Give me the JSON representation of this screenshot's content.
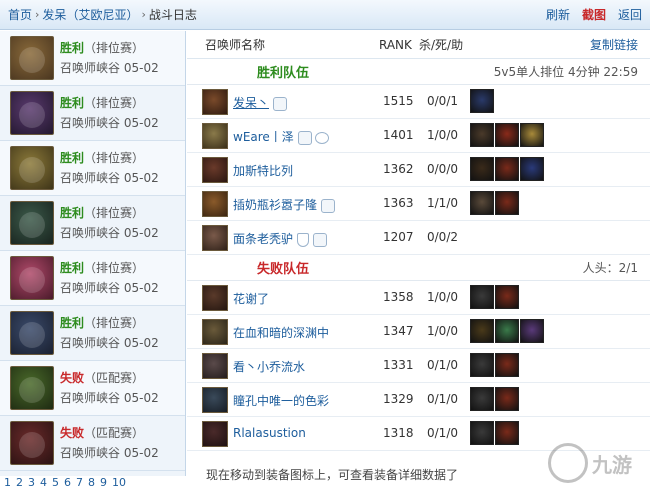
{
  "breadcrumb": {
    "home": "首页",
    "player": "发呆",
    "server": "（艾欧尼亚）",
    "current": "战斗日志",
    "separator": "›"
  },
  "top_actions": {
    "refresh": "刷新",
    "screenshot": "截图",
    "back": "返回"
  },
  "matches": [
    {
      "result": "胜利",
      "mode": "（排位赛）",
      "map": "召唤师峡谷",
      "date": "05-02",
      "win": true,
      "colors": [
        "#8a6a3a",
        "#4a3620"
      ]
    },
    {
      "result": "胜利",
      "mode": "（排位赛）",
      "map": "召唤师峡谷",
      "date": "05-02",
      "win": true,
      "colors": [
        "#5a3a6e",
        "#22172e"
      ]
    },
    {
      "result": "胜利",
      "mode": "（排位赛）",
      "map": "召唤师峡谷",
      "date": "05-02",
      "win": true,
      "colors": [
        "#8c7a3a",
        "#3e3418"
      ]
    },
    {
      "result": "胜利",
      "mode": "（排位赛）",
      "map": "召唤师峡谷",
      "date": "05-02",
      "win": true,
      "colors": [
        "#3c5a4a",
        "#18231e"
      ]
    },
    {
      "result": "胜利",
      "mode": "（排位赛）",
      "map": "召唤师峡谷",
      "date": "05-02",
      "win": true,
      "colors": [
        "#b04a6a",
        "#4a1a2a"
      ]
    },
    {
      "result": "胜利",
      "mode": "（排位赛）",
      "map": "召唤师峡谷",
      "date": "05-02",
      "win": true,
      "colors": [
        "#3a4a6a",
        "#1a2030"
      ]
    },
    {
      "result": "失败",
      "mode": "（匹配赛）",
      "map": "召唤师峡谷",
      "date": "05-02",
      "win": false,
      "colors": [
        "#4a6a2a",
        "#1e2a12"
      ]
    },
    {
      "result": "失败",
      "mode": "（匹配赛）",
      "map": "召唤师峡谷",
      "date": "05-02",
      "win": false,
      "colors": [
        "#6a2a2a",
        "#2a1212"
      ]
    }
  ],
  "pager": [
    "1",
    "2",
    "3",
    "4",
    "5",
    "6",
    "7",
    "8",
    "9",
    "10"
  ],
  "table_header": {
    "name": "召唤师名称",
    "rank": "RANK",
    "kda": "杀/死/助",
    "copy_link": "复制链接"
  },
  "win_team": {
    "title": "胜利队伍",
    "meta": "5v5单人排位 4分钟 22:59",
    "players": [
      {
        "name": "发呆丶",
        "rank": "1515",
        "kda": "0/0/1",
        "icons": "hand",
        "avatar": [
          "#7a4a2a",
          "#2e1a10"
        ],
        "items": [
          "#2a3a6a"
        ]
      },
      {
        "name": "wEare丨泽",
        "rank": "1401",
        "kda": "1/0/0",
        "icons": "hand-circ",
        "avatar": [
          "#8a7a4a",
          "#3a2e18"
        ],
        "items": [
          "#4a3a2a",
          "#8a2a1a",
          "#a88a3a"
        ]
      },
      {
        "name": "加斯特比列",
        "rank": "1362",
        "kda": "0/0/0",
        "icons": "",
        "avatar": [
          "#6a3a2a",
          "#2a1610"
        ],
        "items": [
          "#3a2a1a",
          "#7a2a1a",
          "#2a3a7a"
        ]
      },
      {
        "name": "插奶瓶衫嚣子隆",
        "rank": "1363",
        "kda": "1/1/0",
        "icons": "hand",
        "avatar": [
          "#8a5a2a",
          "#3a2410"
        ],
        "items": [
          "#5a4a3a",
          "#7a2a1a"
        ]
      },
      {
        "name": "面条老秃驴",
        "rank": "1207",
        "kda": "0/0/2",
        "icons": "shield-hand",
        "avatar": [
          "#7a5a4a",
          "#2e2018"
        ],
        "items": []
      }
    ]
  },
  "lose_team": {
    "title": "失败队伍",
    "meta": "人头：2/1",
    "players": [
      {
        "name": "花谢了",
        "rank": "1358",
        "kda": "1/0/0",
        "icons": "",
        "avatar": [
          "#5a3a2a",
          "#241610"
        ],
        "items": [
          "#3a3a3a",
          "#7a2a1a"
        ]
      },
      {
        "name": "在血和暗的深渊中",
        "rank": "1347",
        "kda": "1/0/0",
        "icons": "",
        "avatar": [
          "#6a5a3a",
          "#2a2418"
        ],
        "items": [
          "#4a3a1a",
          "#3a7a4a",
          "#5a3a7a"
        ]
      },
      {
        "name": "看丶小乔流水",
        "rank": "1331",
        "kda": "0/1/0",
        "icons": "",
        "avatar": [
          "#5a4a4a",
          "#241c1c"
        ],
        "items": [
          "#3a3a3a",
          "#7a2a1a"
        ]
      },
      {
        "name": "瞳孔中唯一的色彩",
        "rank": "1329",
        "kda": "0/1/0",
        "icons": "",
        "avatar": [
          "#3a4a5a",
          "#161c24"
        ],
        "items": [
          "#3a3a3a",
          "#7a2a1a"
        ]
      },
      {
        "name": "Rlalasustion",
        "rank": "1318",
        "kda": "0/1/0",
        "icons": "",
        "avatar": [
          "#4a2a2a",
          "#1e1010"
        ],
        "items": [
          "#3a3a3a",
          "#7a2a1a"
        ]
      }
    ]
  },
  "footer_note": "现在移动到装备图标上，可查看装备详细数据了",
  "watermark": {
    "text": "九游"
  },
  "colors": {
    "link": "#1d5d9c",
    "win": "#2d8c1e",
    "lose": "#c8282a"
  }
}
